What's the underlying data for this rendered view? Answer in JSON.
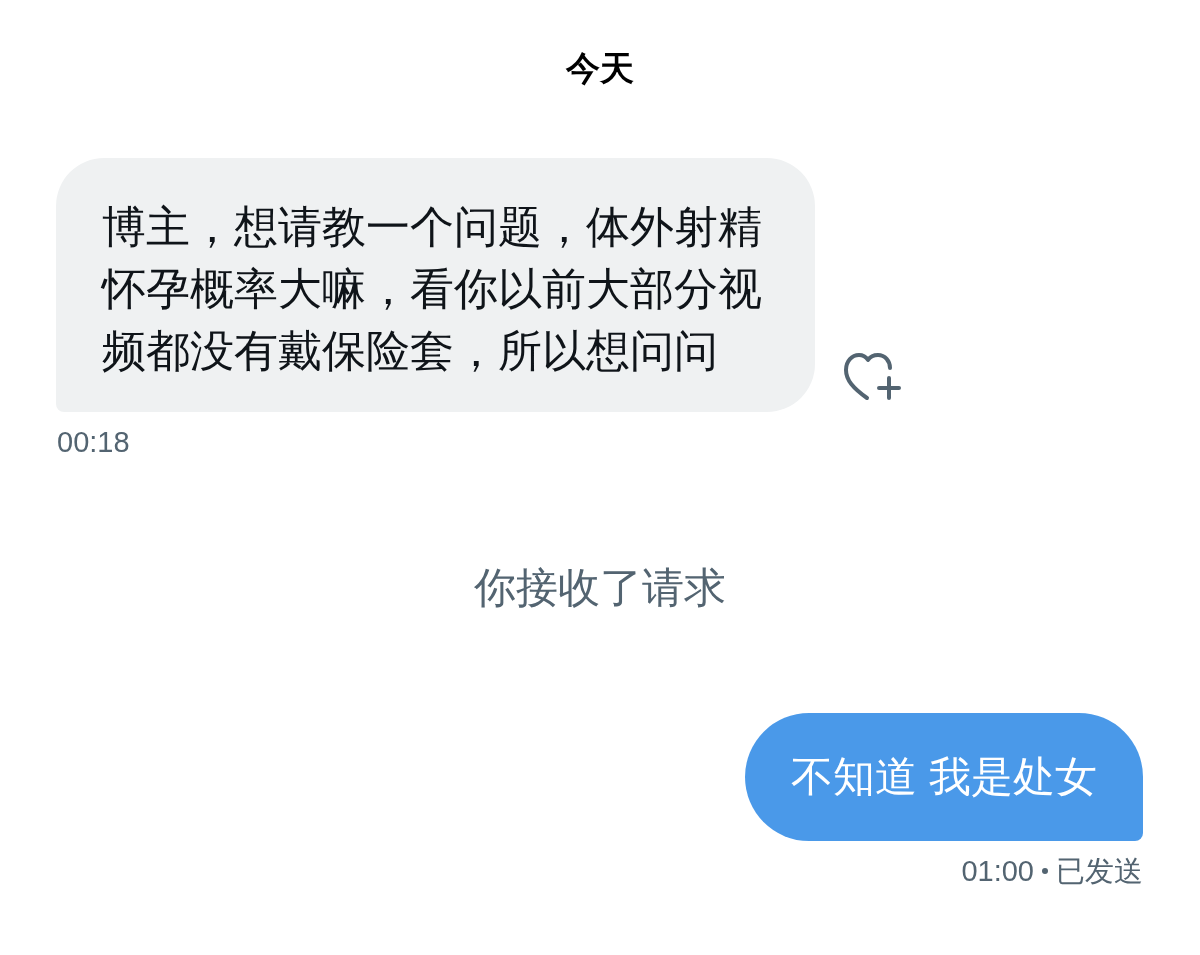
{
  "date_header": "今天",
  "messages": [
    {
      "kind": "received",
      "text": "博主，想请教一个问题，体外射精怀孕概率大嘛，看你以前大部分视频都没有戴保险套，所以想问问",
      "time": "00:18"
    },
    {
      "kind": "notice",
      "text": "你接收了请求"
    },
    {
      "kind": "sent",
      "text": "不知道 我是处女",
      "time": "01:00",
      "status": "已发送"
    }
  ]
}
